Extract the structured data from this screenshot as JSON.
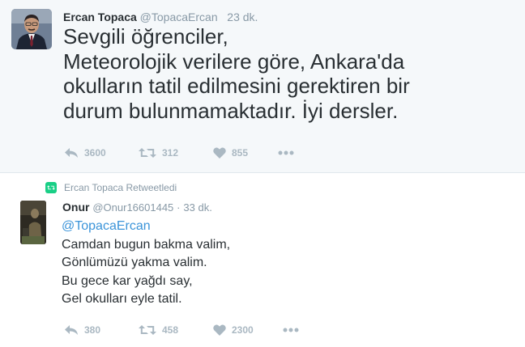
{
  "tweet1": {
    "name": "Ercan Topaca",
    "handle": "@TopacaErcan",
    "time": "23 dk.",
    "lines": [
      "Sevgili öğrenciler,",
      "Meteorolojik verilere göre, Ankara'da",
      "okulların tatil edilmesini  gerektiren bir",
      "durum bulunmamaktadır. İyi dersler."
    ],
    "actions": {
      "reply_count": "3600",
      "retweet_count": "312",
      "like_count": "855"
    }
  },
  "retweet_context": {
    "label": "Ercan Topaca Retweetledi"
  },
  "tweet2": {
    "name": "Onur",
    "handle": "@Onur16601445",
    "separator": "·",
    "time": "33 dk.",
    "mention": "@TopacaErcan",
    "lines": [
      "Camdan bugun bakma valim,",
      "Gönlümüzü yakma valim.",
      "Bu gece kar yağdı say,",
      "Gel okulları eyle tatil."
    ],
    "actions": {
      "reply_count": "380",
      "retweet_count": "458",
      "like_count": "2300"
    }
  },
  "colors": {
    "highlight_background": "#f5f8fa",
    "action_gray": "#aab8c2",
    "meta_gray": "#8899a6",
    "link_blue": "#3b94d9",
    "retweet_green": "#19cf86"
  },
  "icons": [
    "reply-icon",
    "retweet-icon",
    "heart-icon",
    "more-icon"
  ]
}
